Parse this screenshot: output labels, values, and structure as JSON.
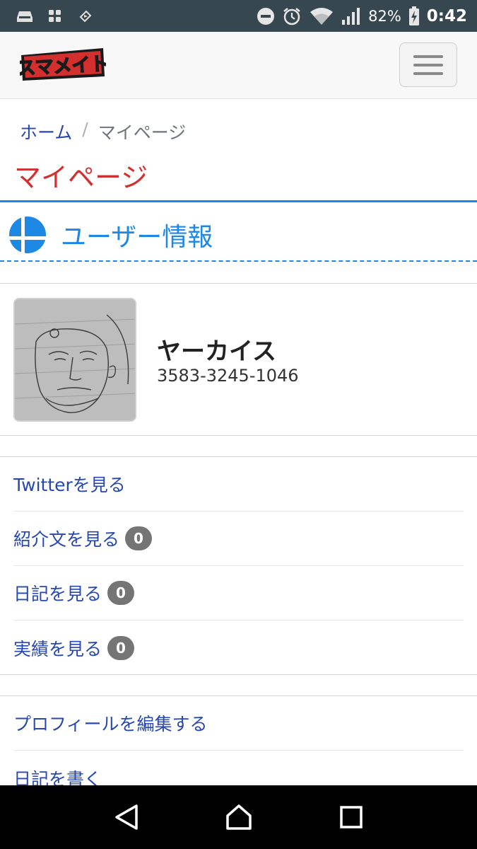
{
  "status_bar": {
    "battery": "82%",
    "time": "0:42"
  },
  "navbar": {
    "logo_text": "スマメイト"
  },
  "breadcrumb": {
    "home": "ホーム",
    "separator": "/",
    "current": "マイページ"
  },
  "page_title": "マイページ",
  "section": {
    "title": "ユーザー情報"
  },
  "profile": {
    "name": "ヤーカイス",
    "code": "3583-3245-1046"
  },
  "links_primary": [
    {
      "label": "Twitterを見る",
      "badge": null
    },
    {
      "label": "紹介文を見る",
      "badge": "0"
    },
    {
      "label": "日記を見る",
      "badge": "0"
    },
    {
      "label": "実績を見る",
      "badge": "0"
    }
  ],
  "links_secondary": [
    {
      "label": "プロフィールを編集する"
    },
    {
      "label": "日記を書く"
    }
  ],
  "colors": {
    "status_bar": "#37474f",
    "title_red": "#d32f2f",
    "accent_blue": "#1e88e5",
    "link_blue": "#2648b0",
    "badge_gray": "#757575"
  }
}
